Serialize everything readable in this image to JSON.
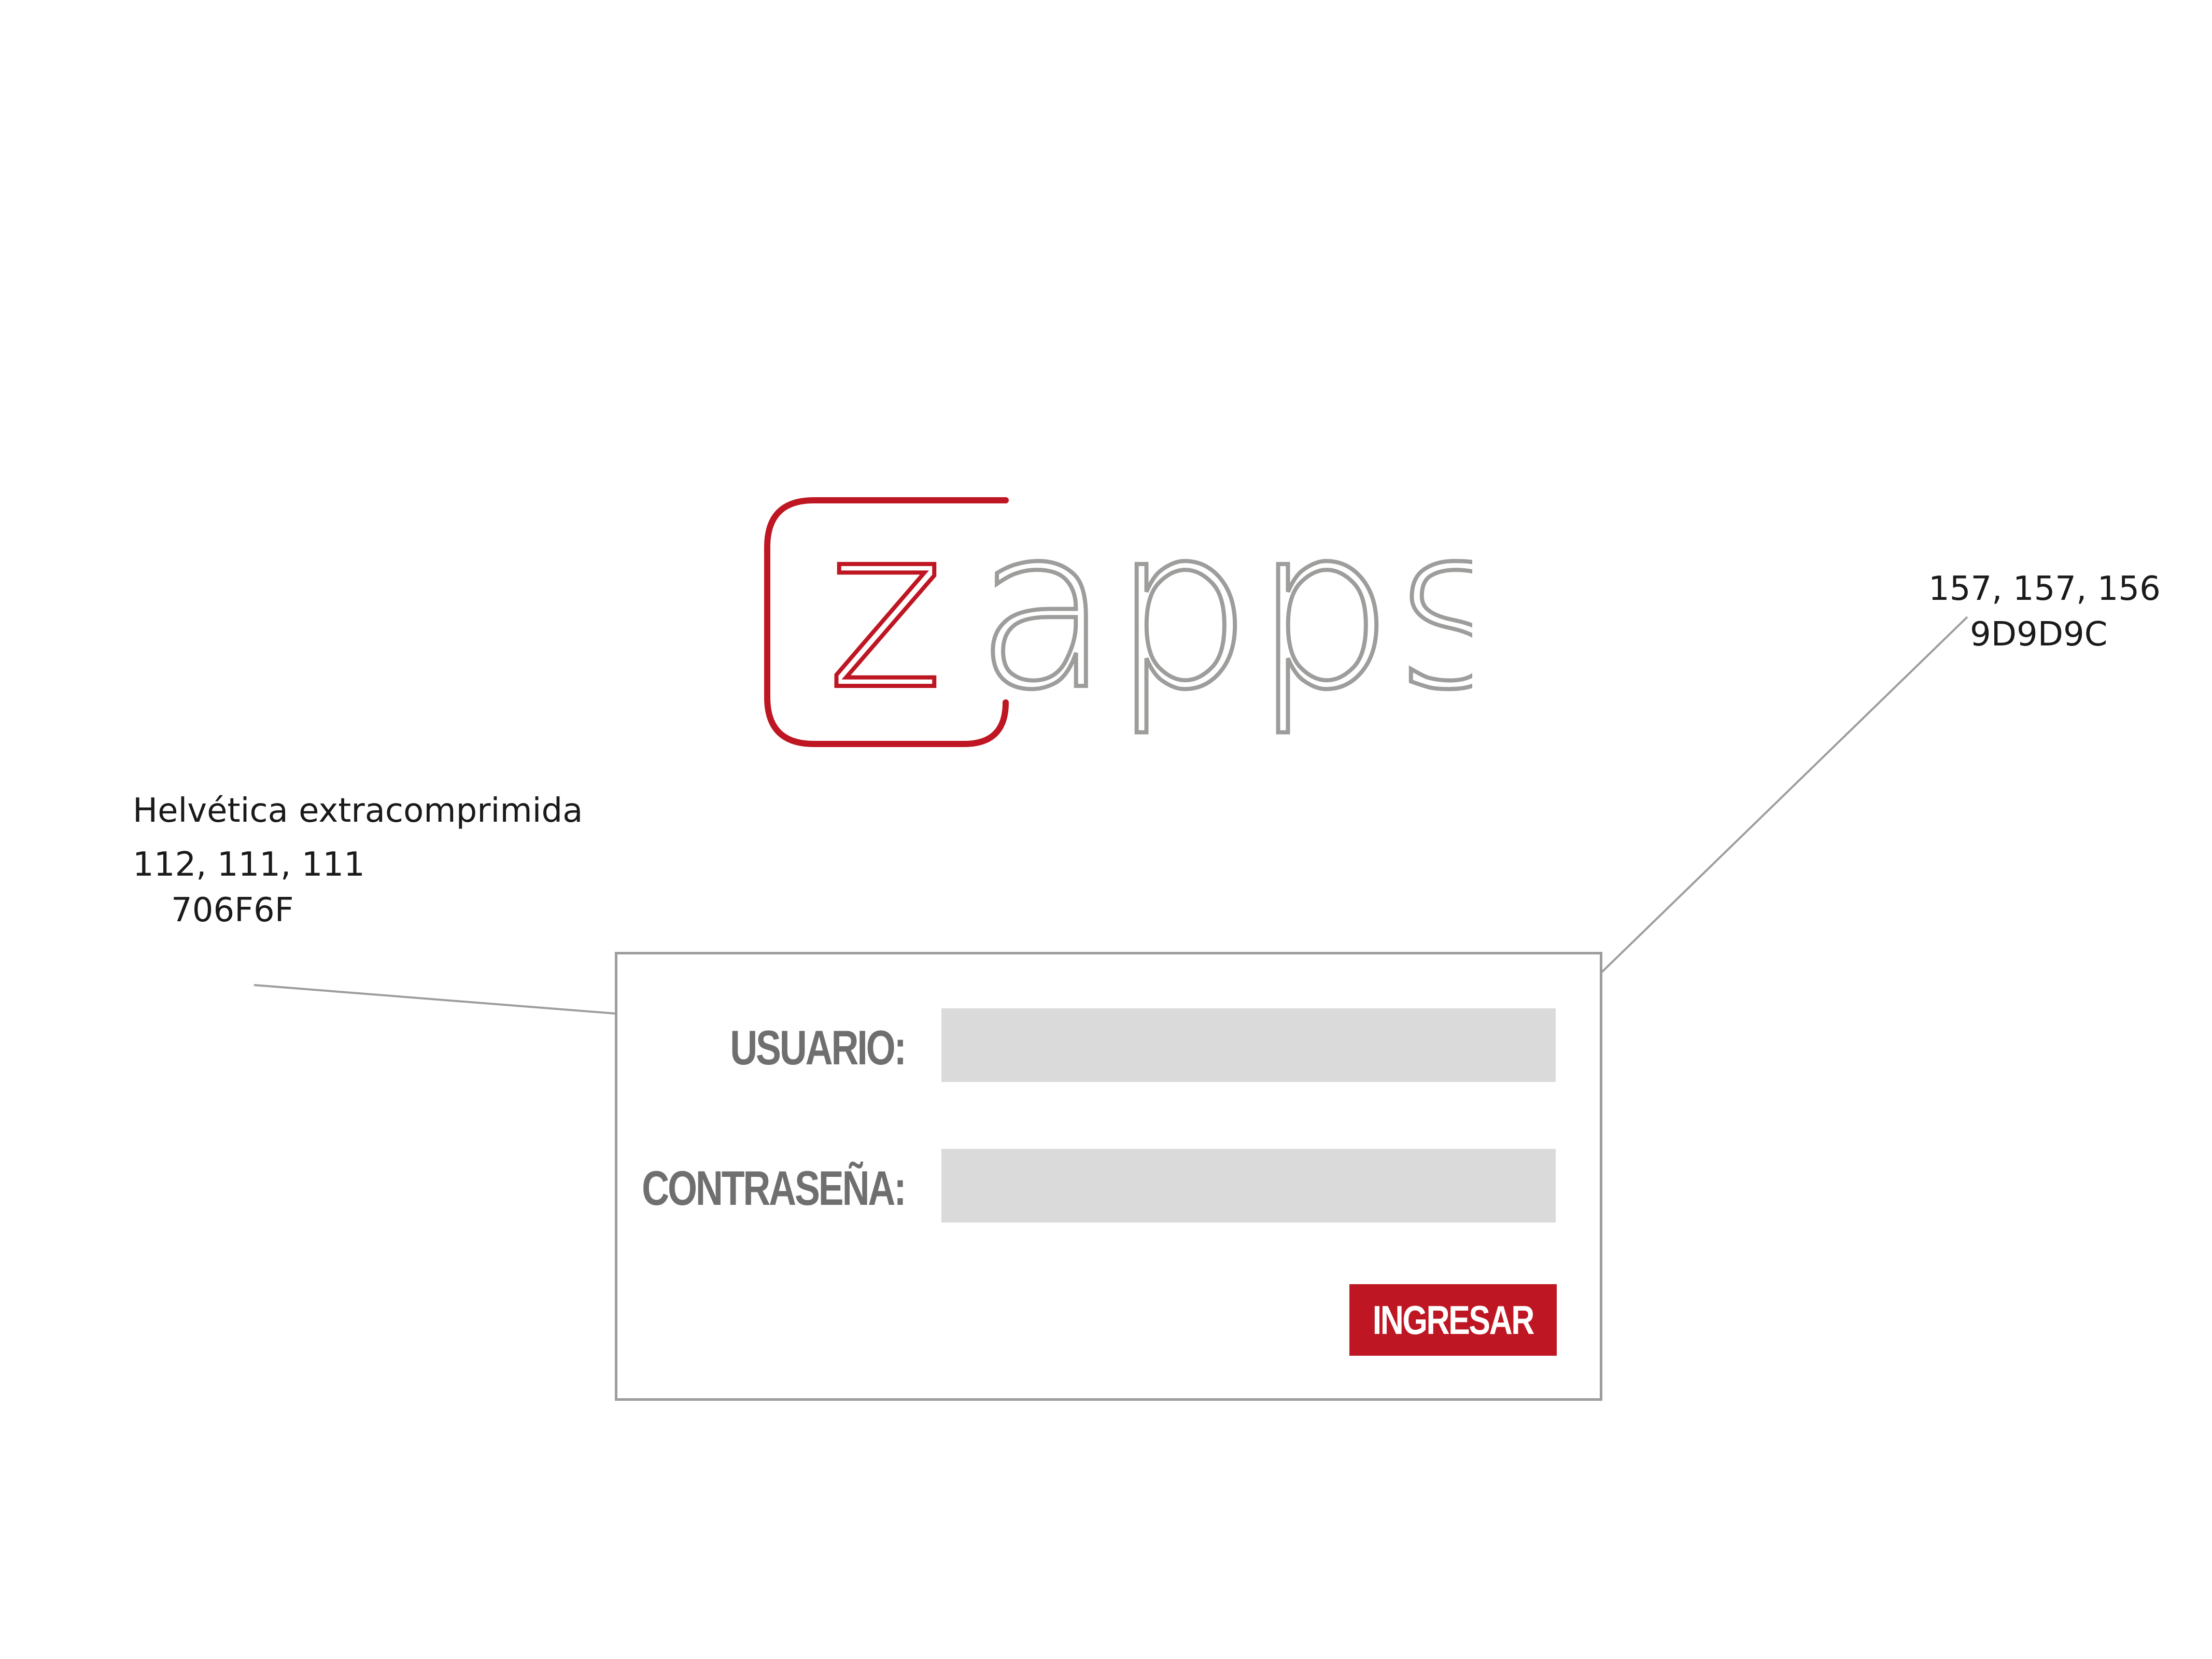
{
  "brand": {
    "logo_text": "zapps",
    "logo_letter": "z",
    "logo_rest": "apps",
    "accent_color": "#be1622",
    "logo_gray": "#9d9d9c"
  },
  "annotations": {
    "font_note": "Helvética extracomprimida",
    "label_rgb": "112, 111, 111",
    "label_hex": "706F6F",
    "border_rgb": "157, 157, 156",
    "border_hex": "9D9D9C"
  },
  "login_form": {
    "username_label": "USUARIO:",
    "username_value": "",
    "password_label": "CONTRASEÑA:",
    "password_value": "",
    "submit_label": "INGRESAR",
    "label_color": "#706f6f",
    "input_bg": "#dadada",
    "panel_border": "#9d9d9c"
  }
}
